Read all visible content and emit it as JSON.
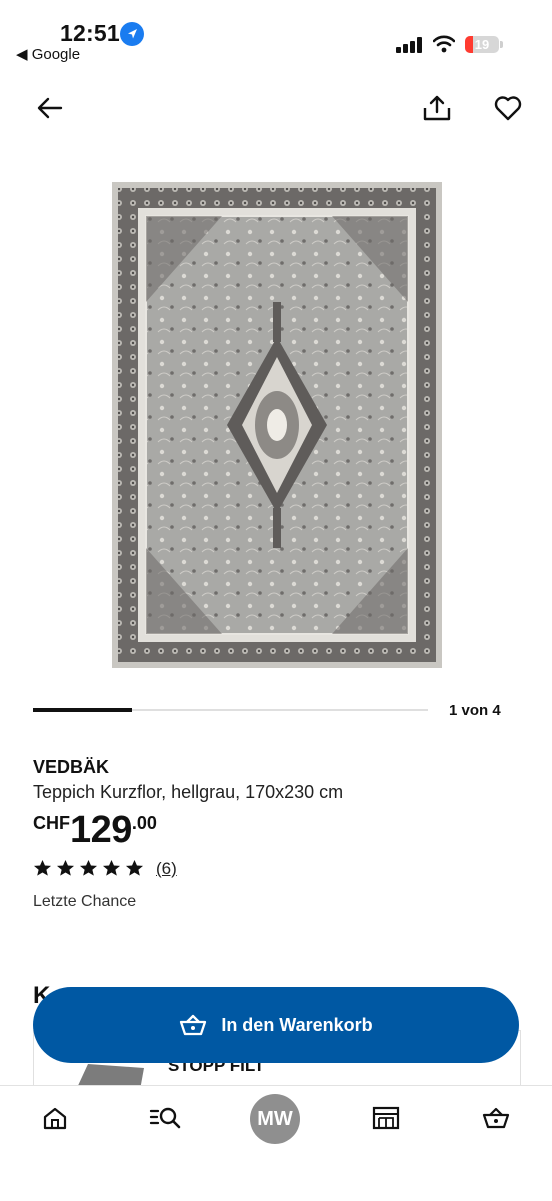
{
  "status_bar": {
    "time": "12:51",
    "back_app": "◀ Google",
    "battery": "19",
    "colors": {
      "location": "#1a7cf0",
      "battery_low": "#ff3b30"
    },
    "icons": [
      "location-arrow-icon",
      "signal-icon",
      "wifi-icon",
      "battery-icon"
    ]
  },
  "nav": {
    "icons": [
      "back-arrow-icon",
      "share-icon",
      "heart-icon"
    ]
  },
  "gallery": {
    "counter": "1 von 4",
    "progress": 0.25
  },
  "product": {
    "name": "VEDBÄK",
    "description": "Teppich Kurzflor, hellgrau, 170x230 cm",
    "price_currency": "CHF",
    "price_int": "129",
    "price_dec": ".00",
    "rating": 5,
    "rating_count": "(6)",
    "availability": "Letzte Chance"
  },
  "peek": {
    "section_title": "K",
    "card_title": "STOPP FILT"
  },
  "cart_button": {
    "label": "In den Warenkorb",
    "color": "#0058a3",
    "icon": "basket-icon"
  },
  "tabbar": {
    "avatar_initials": "MW",
    "icons": [
      "home-icon",
      "search-icon",
      "avatar",
      "store-icon",
      "basket-icon"
    ]
  }
}
